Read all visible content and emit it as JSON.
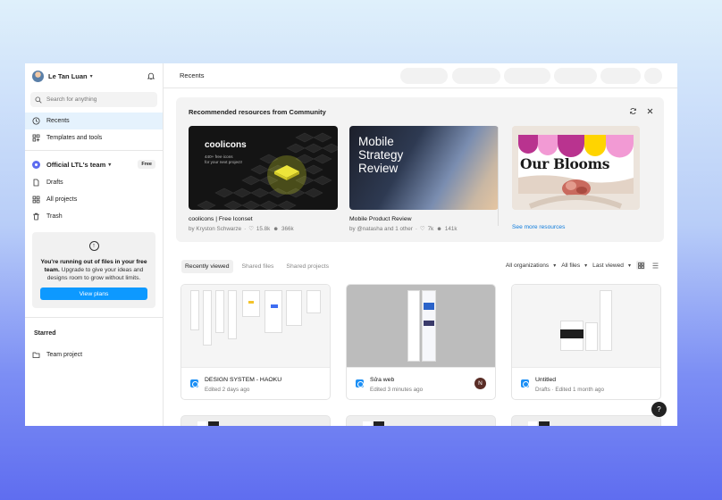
{
  "sidebar": {
    "user_name": "Le Tan Luan",
    "search_placeholder": "Search for anything",
    "nav": [
      {
        "label": "Recents"
      },
      {
        "label": "Templates and tools"
      }
    ],
    "team_name": "Official LTL's team",
    "team_badge": "Free",
    "team_nav": [
      {
        "label": "Drafts"
      },
      {
        "label": "All projects"
      },
      {
        "label": "Trash"
      }
    ],
    "upgrade_bold": "You're running out of files in your free team.",
    "upgrade_text": " Upgrade to give your ideas and designs room to grow without limits.",
    "upgrade_button": "View plans",
    "starred_title": "Starred",
    "starred_items": [
      {
        "label": "Team project"
      }
    ]
  },
  "header": {
    "title": "Recents"
  },
  "recommended": {
    "title": "Recommended resources from Community",
    "see_more": "See more resources",
    "cards": [
      {
        "name": "coolicons | Free Iconset",
        "author": "by Kryston Schwarze",
        "likes": "15.8k",
        "users": "366k",
        "thumb_title": "coolicons",
        "thumb_sub": "440+ free icons\nfor your next project!"
      },
      {
        "name": "Mobile Product Review",
        "author": "by @natasha and 1 other",
        "likes": "7k",
        "users": "141k",
        "thumb_title": "Mobile\nStrategy\nReview"
      }
    ],
    "bloom_text": "Our Blooms"
  },
  "tabs": [
    {
      "label": "Recently viewed"
    },
    {
      "label": "Shared files"
    },
    {
      "label": "Shared projects"
    }
  ],
  "filters": [
    {
      "label": "All organizations"
    },
    {
      "label": "All files"
    },
    {
      "label": "Last viewed"
    }
  ],
  "files": [
    {
      "name": "DESIGN SYSTEM - HAOKU",
      "meta": "Edited 2 days ago"
    },
    {
      "name": "Sửa web",
      "meta": "Edited 3 minutes ago",
      "avatar": "N"
    },
    {
      "name": "Untitled",
      "meta": "Drafts · Edited 1 month ago"
    }
  ],
  "help": "?",
  "colors": {
    "accent": "#0d99ff",
    "active_nav": "#e5f2fd"
  }
}
